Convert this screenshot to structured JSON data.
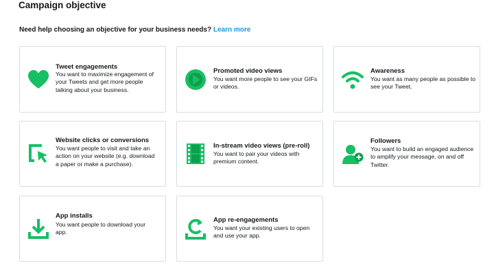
{
  "page": {
    "title": "Campaign objective",
    "help_text": "Need help choosing an objective for your business needs?",
    "learn_more": "Learn more"
  },
  "accent_color": "#17bf63",
  "link_color": "#1b95e0",
  "objectives": [
    {
      "icon": "heart-icon",
      "title": "Tweet engagements",
      "desc_lines": [
        "You want to maximize engagement of",
        "your Tweets and get more people",
        "talking about your business."
      ]
    },
    {
      "icon": "play-circle-icon",
      "title": "Promoted video views",
      "desc_lines": [
        "You want more people to see your GIFs",
        "or videos."
      ]
    },
    {
      "icon": "wifi-signal-icon",
      "title": "Awareness",
      "desc_lines": [
        "You want as many people as possible to",
        "see your Tweet."
      ]
    },
    {
      "icon": "cursor-click-icon",
      "title": "Website clicks or conversions",
      "desc_lines": [
        "You want people to visit and take an",
        "action on your website (e.g. download",
        "a paper or make a purchase)."
      ]
    },
    {
      "icon": "film-strip-icon",
      "title": "In-stream video views (pre-roll)",
      "desc_lines": [
        "You want to pair your videos with",
        "premium content."
      ]
    },
    {
      "icon": "person-add-icon",
      "title": "Followers",
      "desc_lines": [
        "You want to build an engaged audience",
        "to amplify your message, on and off",
        "Twitter."
      ]
    },
    {
      "icon": "download-icon",
      "title": "App installs",
      "desc_lines": [
        "You want people to download your",
        "app."
      ]
    },
    {
      "icon": "refresh-icon",
      "title": "App re-engagements",
      "desc_lines": [
        "You want your existing users to open",
        "and use your app."
      ]
    }
  ]
}
